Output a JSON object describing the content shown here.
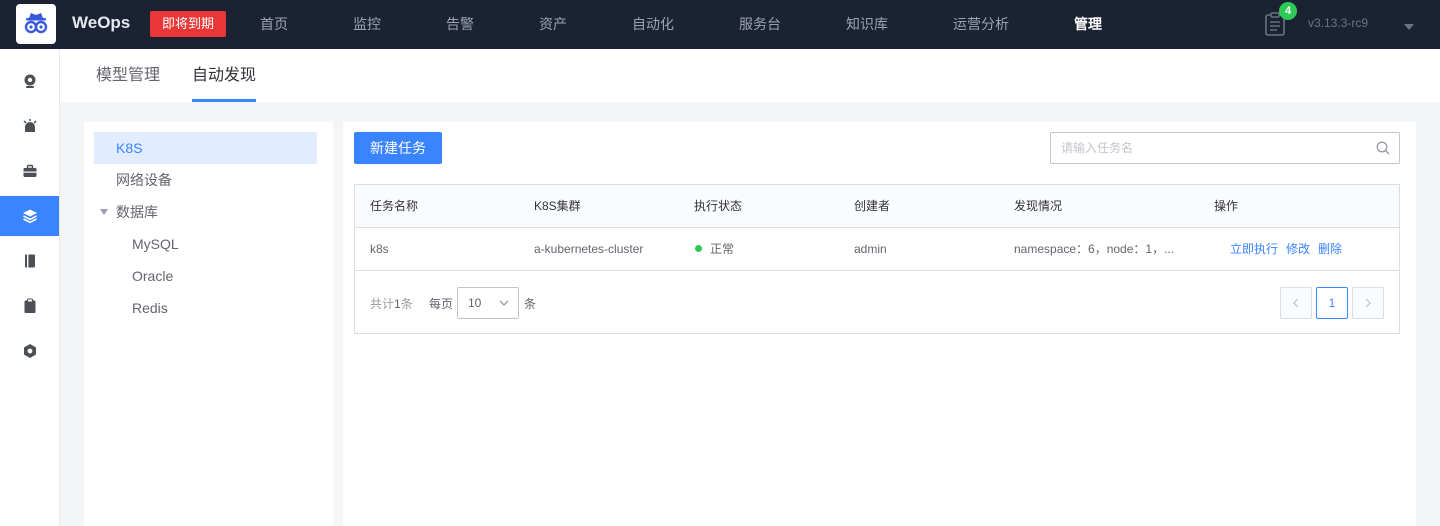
{
  "header": {
    "brand": "WeOps",
    "expire_badge": "即将到期",
    "nav": [
      {
        "label": "首页"
      },
      {
        "label": "监控"
      },
      {
        "label": "告警"
      },
      {
        "label": "资产"
      },
      {
        "label": "自动化"
      },
      {
        "label": "服务台"
      },
      {
        "label": "知识库"
      },
      {
        "label": "运营分析"
      },
      {
        "label": "管理",
        "active": true
      }
    ],
    "notification_count": "4",
    "version": "v3.13.3-rc9"
  },
  "sidebar": {
    "items": [
      {
        "icon": "monitor-icon"
      },
      {
        "icon": "alarm-icon"
      },
      {
        "icon": "briefcase-icon"
      },
      {
        "icon": "layers-icon",
        "active": true
      },
      {
        "icon": "book-icon"
      },
      {
        "icon": "clipboard-icon"
      },
      {
        "icon": "settings-hex-icon"
      }
    ]
  },
  "tabs": [
    {
      "label": "模型管理"
    },
    {
      "label": "自动发现",
      "active": true
    }
  ],
  "tree": {
    "nodes": [
      {
        "label": "K8S",
        "selected": true
      },
      {
        "label": "网络设备"
      },
      {
        "label": "数据库",
        "expanded": true
      },
      {
        "label": "MySQL"
      },
      {
        "label": "Oracle"
      },
      {
        "label": "Redis"
      }
    ]
  },
  "toolbar": {
    "new_task_label": "新建任务",
    "search_placeholder": "请输入任务名"
  },
  "table": {
    "columns": [
      "任务名称",
      "K8S集群",
      "执行状态",
      "创建者",
      "发现情况",
      "操作"
    ],
    "rows": [
      {
        "name": "k8s",
        "cluster": "a-kubernetes-cluster",
        "status": "正常",
        "creator": "admin",
        "discovery": "namespace：6，node：1，...",
        "actions": [
          "立即执行",
          "修改",
          "删除"
        ]
      }
    ]
  },
  "pagination": {
    "total_prefix": "共计",
    "total_count": "1",
    "total_suffix": "条",
    "per_page_label": "每页",
    "per_page_value": "10",
    "per_page_unit": "条",
    "current_page": "1"
  },
  "colors": {
    "topnav_bg": "#1b2232",
    "primary": "#3a84ff",
    "danger": "#ea3636",
    "success": "#2dcb56"
  }
}
